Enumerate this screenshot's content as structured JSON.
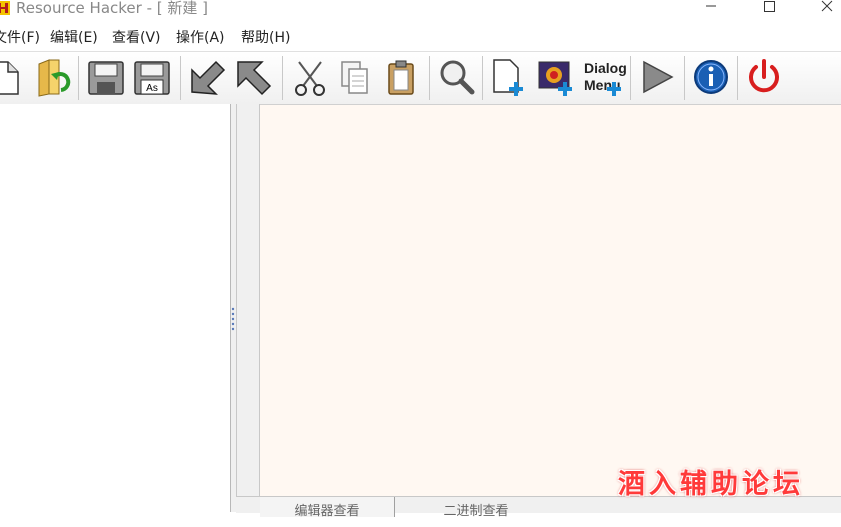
{
  "window": {
    "title": "Resource Hacker - [ 新建 ]"
  },
  "menu": [
    {
      "label": "文件(F)"
    },
    {
      "label": "编辑(E)"
    },
    {
      "label": "查看(V)"
    },
    {
      "label": "操作(A)"
    },
    {
      "label": "帮助(H)"
    }
  ],
  "toolbar": {
    "dialog_menu_label_line1": "Dialog",
    "dialog_menu_label_line2": "Menu",
    "save_as_badge": "As"
  },
  "tabs": [
    {
      "label": "编辑器查看"
    },
    {
      "label": "二进制查看"
    }
  ],
  "watermark": {
    "text": "酒入辅助论坛"
  },
  "colors": {
    "editor_bg": "#fff8f2",
    "accent_red": "#d81e1e",
    "accent_blue": "#1a5fb4"
  }
}
